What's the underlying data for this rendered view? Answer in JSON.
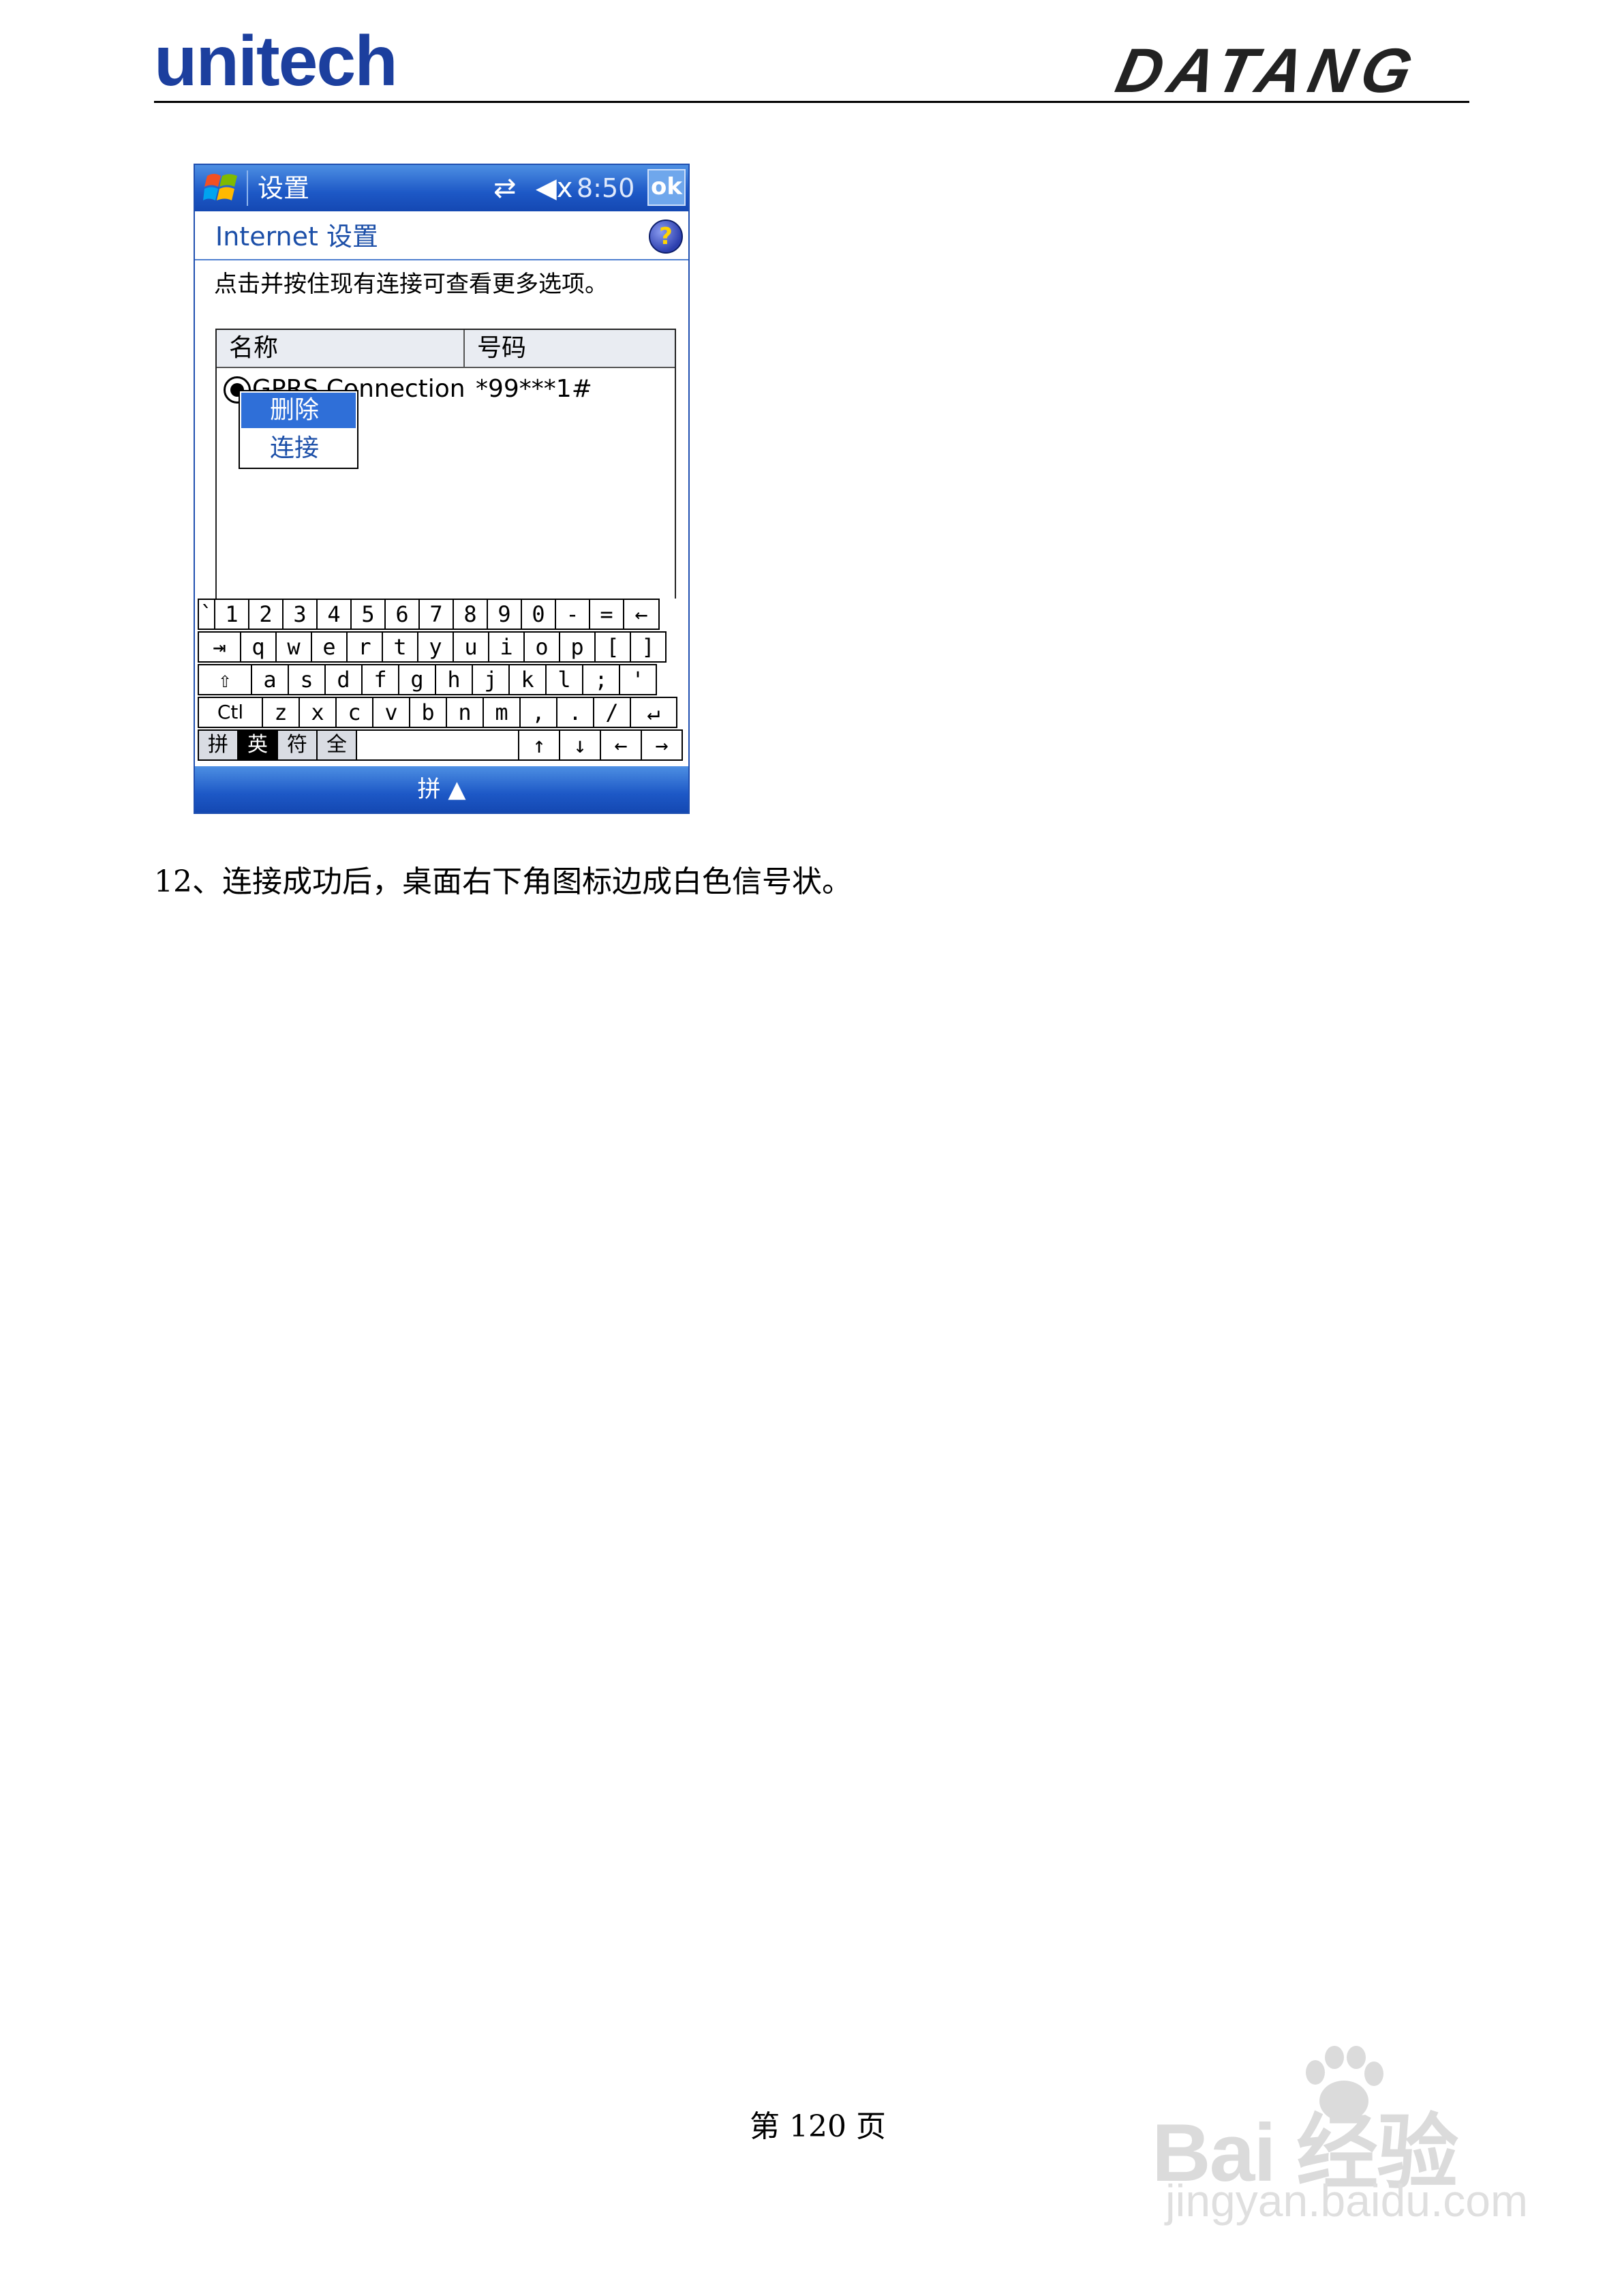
{
  "header": {
    "left_logo": "unitech",
    "right_logo": "DATANG"
  },
  "device": {
    "title_bar": {
      "title": "设置",
      "clock": "8:50",
      "ok_label": "ok",
      "connectivity_icon": "connectivity-arrows-icon",
      "speaker_icon": "speaker-muted-icon",
      "start_icon": "windows-flag-icon"
    },
    "page_heading": "Internet 设置",
    "help_icon": "help-icon",
    "instruction": "点击并按住现有连接可查看更多选项。",
    "list": {
      "columns": [
        "名称",
        "号码"
      ],
      "rows": [
        {
          "name": "GPRS Connection",
          "number": "*99***1#"
        }
      ]
    },
    "context_menu": {
      "items": [
        "删除",
        "连接"
      ],
      "highlighted": "删除"
    },
    "keyboard": {
      "row1": [
        "`",
        "1",
        "2",
        "3",
        "4",
        "5",
        "6",
        "7",
        "8",
        "9",
        "0",
        "-",
        "=",
        "←"
      ],
      "row2": [
        "⇥",
        "q",
        "w",
        "e",
        "r",
        "t",
        "y",
        "u",
        "i",
        "o",
        "p",
        "[",
        "]"
      ],
      "row3": [
        "⇧",
        "a",
        "s",
        "d",
        "f",
        "g",
        "h",
        "j",
        "k",
        "l",
        ";",
        "'"
      ],
      "row4": [
        "Ctl",
        "z",
        "x",
        "c",
        "v",
        "b",
        "n",
        "m",
        ",",
        ".",
        "/",
        "↵"
      ],
      "row5_ime": [
        "拼",
        "英",
        "符",
        "全"
      ],
      "row5_arrows": [
        "↑",
        "↓",
        "←",
        "→"
      ],
      "active_ime": "英"
    },
    "bottom_bar": {
      "input_mode": "拼 ▲"
    }
  },
  "caption": "12、连接成功后，桌面右下角图标边成白色信号状。",
  "page_number": "第 120 页",
  "watermark": {
    "brand": "Bai 经验",
    "url": "jingyan.baidu.com"
  }
}
